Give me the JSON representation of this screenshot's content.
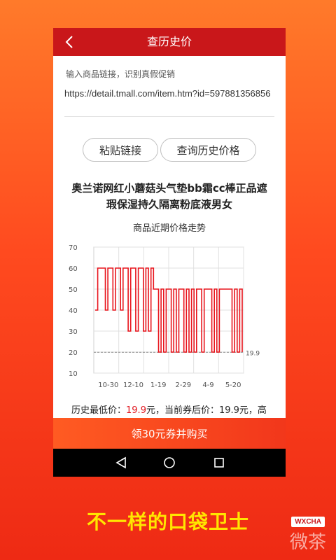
{
  "header": {
    "title": "查历史价"
  },
  "input": {
    "hint": "输入商品链接，识别真假促销",
    "url": "https://detail.tmall.com/item.htm?id=597881356856"
  },
  "buttons": {
    "paste": "粘贴链接",
    "query": "查询历史价格"
  },
  "product": {
    "title": "奥兰诺网红小蘑菇头气垫bb霜cc棒正品遮瑕保湿持久隔离粉底液男女"
  },
  "chart_data": {
    "type": "line",
    "title": "商品近期价格走势",
    "xlabel": "",
    "ylabel": "",
    "ylim": [
      10,
      70
    ],
    "yticks": [
      "70",
      "60",
      "50",
      "40",
      "30",
      "20",
      "10"
    ],
    "categories": [
      "10-30",
      "12-10",
      "1-19",
      "2-29",
      "4-9",
      "5-20"
    ],
    "reference_line": {
      "value": 19.9,
      "label": "19.9"
    },
    "line_color": "#e8141c",
    "series": [
      {
        "values": [
          40,
          60,
          60,
          60,
          40,
          60,
          60,
          40,
          60,
          60,
          40,
          60,
          60,
          30,
          60,
          60,
          30,
          60,
          60,
          30,
          60,
          30,
          60,
          50,
          50,
          20,
          50,
          20,
          50,
          50,
          20,
          50,
          20,
          50,
          50,
          20,
          50,
          20,
          50,
          20,
          50,
          50,
          20,
          50,
          50,
          50,
          20,
          50,
          20,
          50,
          50,
          50,
          50,
          50,
          20,
          50,
          20,
          50,
          20
        ]
      }
    ]
  },
  "summary": {
    "prefix": "历史最低价：",
    "lowest": "19.9",
    "mid": "元，当前券后价：19.9元，高"
  },
  "buy_bar": {
    "label": "领30元券并购买"
  },
  "navbar": {
    "back": "back-triangle-icon",
    "home": "home-circle-icon",
    "recent": "recent-square-icon"
  },
  "slogan": "不一样的口袋卫士",
  "watermark": {
    "badge": "WXCHA",
    "text": "微茶"
  }
}
